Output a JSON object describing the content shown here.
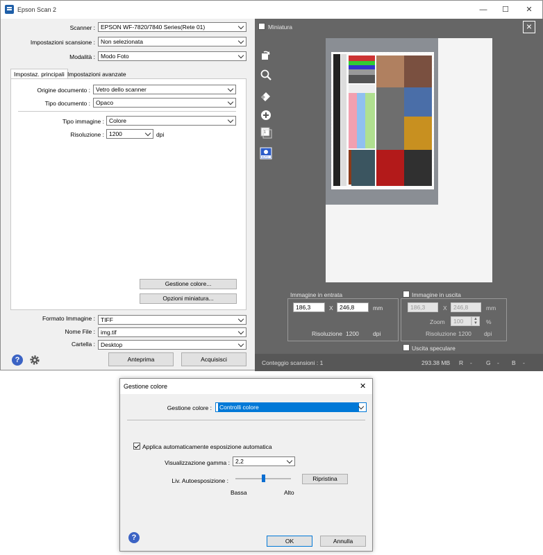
{
  "window": {
    "title": "Epson Scan 2",
    "minimize": "—",
    "maximize": "☐",
    "close": "✕"
  },
  "top_fields": {
    "scanner_label": "Scanner :",
    "scanner_value": "EPSON WF-7820/7840 Series(Rete 01)",
    "preset_label": "Impostazioni scansione :",
    "preset_value": "Non selezionata",
    "mode_label": "Modalità :",
    "mode_value": "Modo Foto"
  },
  "tabs": {
    "main": "Impostaz. principali",
    "advanced": "Impostazioni avanzate"
  },
  "main_settings": {
    "source_label": "Origine documento :",
    "source_value": "Vetro dello scanner",
    "doctype_label": "Tipo documento :",
    "doctype_value": "Opaco",
    "imagetype_label": "Tipo immagine :",
    "imagetype_value": "Colore",
    "resolution_label": "Risoluzione :",
    "resolution_value": "1200",
    "resolution_unit": "dpi",
    "color_mgmt_button": "Gestione colore...",
    "thumb_options_button": "Opzioni miniatura..."
  },
  "output": {
    "format_label": "Formato Immagine :",
    "format_value": "TIFF",
    "filename_label": "Nome File :",
    "filename_value": "img.tif",
    "folder_label": "Cartella :",
    "folder_value": "Desktop"
  },
  "actions": {
    "preview": "Anteprima",
    "scan": "Acquisisci"
  },
  "preview": {
    "thumbnail_label": "Miniatura",
    "input_group_label": "Immagine in entrata",
    "input_width": "186,3",
    "input_x": "X",
    "input_height": "246,8",
    "input_unit": "mm",
    "input_res_label": "Risoluzione",
    "input_res_value": "1200",
    "input_res_unit": "dpi",
    "output_group_label": "Immagine in uscita",
    "output_width": "186,3",
    "output_x": "X",
    "output_height": "246,8",
    "output_unit": "mm",
    "zoom_label": "Zoom",
    "zoom_value": "100",
    "zoom_unit": "%",
    "output_res_label": "Risoluzione",
    "output_res_value": "1200",
    "output_res_unit": "dpi",
    "mirror_label": "Uscita speculare"
  },
  "status": {
    "scan_count": "Conteggio scansioni : 1",
    "size": "293.38 MB",
    "r": "R",
    "r_dash": "-",
    "g": "G",
    "g_dash": "-",
    "b": "B",
    "b_dash": "-"
  },
  "dialog": {
    "title": "Gestione colore",
    "close": "✕",
    "mgmt_label": "Gestione colore :",
    "mgmt_value": "Controlli colore",
    "auto_exposure_label": "Applica automaticamente esposizione automatica",
    "gamma_label": "Visualizzazione gamma :",
    "gamma_value": "2,2",
    "auto_level_label": "Liv. Autoesposizione :",
    "auto_level_value": 0.5,
    "reset_button": "Ripristina",
    "low_label": "Bassa",
    "high_label": "Alto",
    "ok_button": "OK",
    "cancel_button": "Annulla"
  },
  "colors": {
    "accent": "#0078d7",
    "preview_bg": "#666666",
    "help_blue": "#3b63c4"
  }
}
